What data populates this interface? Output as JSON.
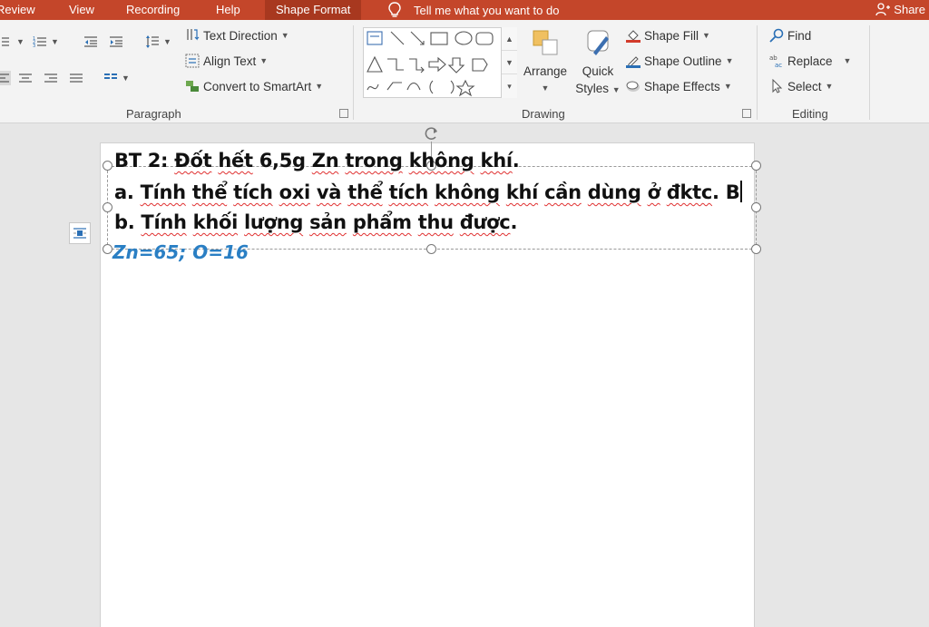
{
  "tabs": {
    "review": "Review",
    "view": "View",
    "recording": "Recording",
    "help": "Help",
    "shape_format": "Shape Format",
    "tell_me": "Tell me what you want to do",
    "share": "Share"
  },
  "ribbon": {
    "paragraph": {
      "text_direction": "Text Direction",
      "align_text": "Align Text",
      "convert_smartart": "Convert to SmartArt",
      "label": "Paragraph"
    },
    "drawing": {
      "arrange": "Arrange",
      "quick": "Quick",
      "styles": "Styles",
      "shape_fill": "Shape Fill",
      "shape_outline": "Shape Outline",
      "shape_effects": "Shape Effects",
      "label": "Drawing"
    },
    "editing": {
      "find": "Find",
      "replace": "Replace",
      "select": "Select",
      "label": "Editing"
    }
  },
  "slide": {
    "line1_a": "BT 2: ",
    "line1_b": "Đốt",
    "line1_c": " ",
    "line1_d": "hết",
    "line1_e": " 6,5g ",
    "line1_f": "Zn",
    "line1_g": " ",
    "line1_h": "trong",
    "line1_i": " ",
    "line1_j": "không",
    "line1_k": " ",
    "line1_l": "khí",
    "line1_m": ".",
    "line2_a": "a. ",
    "line2_b": "Tính",
    "line2_c": " ",
    "line2_d": "thể",
    "line2_e": " ",
    "line2_f": "tích",
    "line2_g": " ",
    "line2_h": "oxi",
    "line2_i": " ",
    "line2_j": "và",
    "line2_k": " ",
    "line2_l": "thể",
    "line2_m": " ",
    "line2_n": "tích",
    "line2_o": " ",
    "line2_p": "không",
    "line2_q": " ",
    "line2_r": "khí",
    "line2_s": " ",
    "line2_t": "cần",
    "line2_u": " ",
    "line2_v": "dùng",
    "line2_w": " ",
    "line2_x": "ở",
    "line2_y": " ",
    "line2_z": "đktc",
    "line2_end": ". B",
    "line3_a": "b. ",
    "line3_b": "Tính",
    "line3_c": " ",
    "line3_d": "khối",
    "line3_e": " ",
    "line3_f": "lượng",
    "line3_g": " ",
    "line3_h": "sản",
    "line3_i": " ",
    "line3_j": "phẩm",
    "line3_k": " ",
    "line3_l": "thu",
    "line3_m": " ",
    "line3_n": "được",
    "line3_o": ".",
    "line4": "Zn=65; O=16"
  },
  "colors": {
    "tab_bar": "#c4462a",
    "active_tab": "#a8381f",
    "accent_blue": "#2a7fc4",
    "spell_squiggle": "#e03030"
  }
}
